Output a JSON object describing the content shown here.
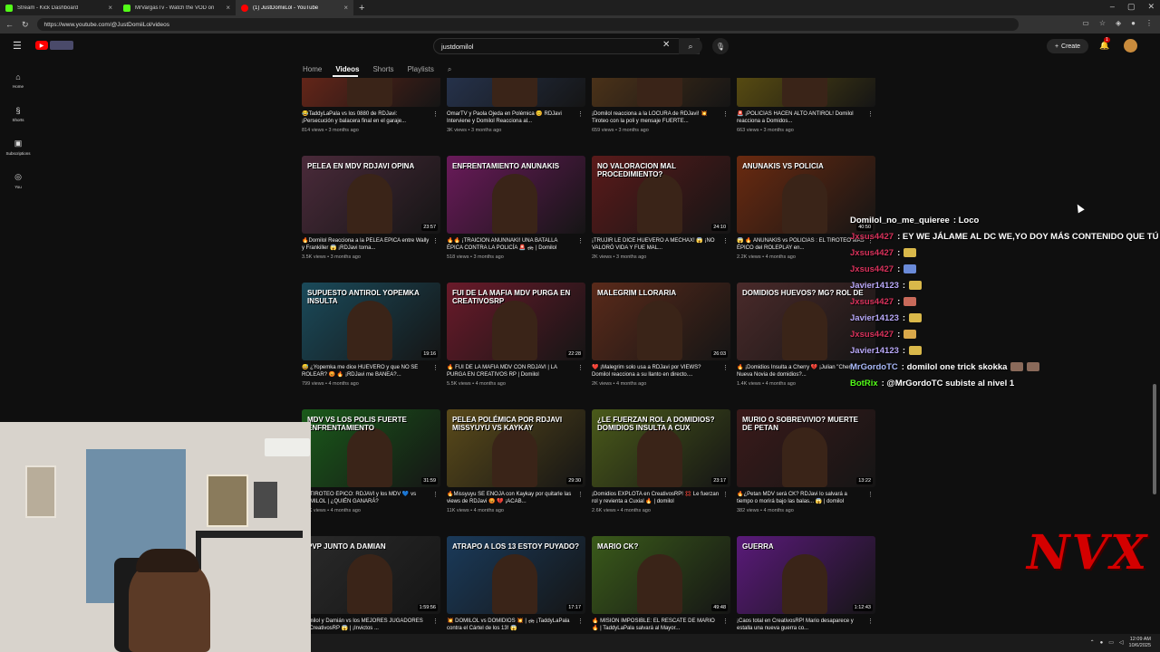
{
  "browser": {
    "tabs": [
      {
        "label": "Stream - Kick Dashboard",
        "color": "#53fc18"
      },
      {
        "label": "MrVargasTv - Watch the VOD on",
        "color": "#53fc18"
      },
      {
        "label": "(1) JustDomiiLol - YouTube",
        "color": "#ff0000"
      }
    ],
    "url": "https://www.youtube.com/@JustDomiiLol/videos"
  },
  "youtube": {
    "search_value": "justdomilol",
    "create_label": "Create",
    "notif_count": "1",
    "sidebar": [
      {
        "icon": "⌂",
        "label": "Home"
      },
      {
        "icon": "§",
        "label": "Shorts"
      },
      {
        "icon": "▣",
        "label": "Subscriptions"
      },
      {
        "icon": "◎",
        "label": "You"
      }
    ],
    "channel_tabs": {
      "home": "Home",
      "videos": "Videos",
      "shorts": "Shorts",
      "playlists": "Playlists"
    }
  },
  "videos": [
    {
      "title": "😂TaddyLaPala vs los 0880 de RDJavi: ¡Persecución y balacera final en el garaje...",
      "meta": "814 views • 3 months ago",
      "thumb_text": "",
      "duration": "",
      "color": "#7a2a1a"
    },
    {
      "title": "OmarTV y Paola Ojeda en Polémica 😊 RDJavi Interviene y Domilol Reacciona al...",
      "meta": "3K views • 3 months ago",
      "thumb_text": "",
      "duration": "",
      "color": "#2a3a5a"
    },
    {
      "title": "¡Domilol reacciona a la LOCURA de RDJavi! 💥 Tiroteo con la poli y mensaje FUERTE...",
      "meta": "659 views • 3 months ago",
      "thumb_text": "",
      "duration": "",
      "color": "#5a3a1a"
    },
    {
      "title": "🚨 ¡POLICÍAS HACEN ALTO ANTIROL! Domilol reacciona a Domidos...",
      "meta": "663 views • 3 months ago",
      "thumb_text": "",
      "duration": "",
      "color": "#6a5a10"
    },
    {
      "title": "🔥Domilol Reacciona a la PELEA ÉPICA entre Wally y Frankiller 😱 ¡RDJavi toma...",
      "meta": "3.5K views • 3 months ago",
      "thumb_text": "PELEA EN MDV RDJAVI OPINA",
      "duration": "23:57",
      "color": "#4a2a3a"
    },
    {
      "title": "🔥🔥 ¡TRAICIÓN ANUNNAKI! UNA BATALLA ÉPICA CONTRA LA POLICÍA 🚨 🚓 | Domilol",
      "meta": "518 views • 3 months ago",
      "thumb_text": "ENFRENTAMIENTO ANUNAKIS",
      "duration": "",
      "color": "#6a1a5a"
    },
    {
      "title": "¡TRUJIR LE DICE HUEVERO A MECHAX! 😱 ¡NO VALORÓ VIDA Y FUE MAL...",
      "meta": "2K views • 3 months ago",
      "thumb_text": "NO VALORACION MAL PROCEDIMIENTO?",
      "duration": "24:10",
      "color": "#5a1a1a"
    },
    {
      "title": "😱 🔥 ANUNAKIS vs POLICIAS : EL TIROTEO MÁS ÉPICO del ROLEPLAY en...",
      "meta": "2.2K views • 4 months ago",
      "thumb_text": "ANUNAKIS VS POLICIA",
      "duration": "40:50",
      "color": "#6a2a10"
    },
    {
      "title": "😅 ¿Yopemka me dice HUEVERO y que NO SÉ ROLEAR? 😡 🔥 ¡RDJavi me BANEA?...",
      "meta": "799 views • 4 months ago",
      "thumb_text": "SUPUESTO ANTIROL YOPEMKA INSULTA",
      "duration": "19:16",
      "color": "#1a4a5a"
    },
    {
      "title": "🔥 FUI DE LA MAFIA MDV CON RDJAVI | LA PURGA EN CREATIVOS RP | Domilol",
      "meta": "5.5K views • 4 months ago",
      "thumb_text": "FUI DE LA MAFIA MDV PURGA EN CREATIVOSRP",
      "duration": "22:28",
      "color": "#6a1a2a"
    },
    {
      "title": "❤️ ¡Malegrim solo usa a RDJavi por VIEWS? Domilol reacciona a su llanto en directo....",
      "meta": "2K views • 4 months ago",
      "thumb_text": "MALEGRIM LLORARIA",
      "duration": "26:03",
      "color": "#5a2a1a"
    },
    {
      "title": "🔥 ¡Domidios Insulta a Cherry 💔 ¡Julian \"Cherry\" Nueva Novia de domidios?...",
      "meta": "1.4K views • 4 months ago",
      "thumb_text": "DOMIDIOS HUEVOS? MG? ROL DE",
      "duration": "",
      "color": "#4a2a2a"
    },
    {
      "title": "💥 TIROTEO ÉPICO: RDJAVI y los MDV 💙 vs DOMILOL | ¿QUIÉN GANARÁ?",
      "meta": "3.1K views • 4 months ago",
      "thumb_text": "MDV VS LOS POLIS FUERTE ENFRENTAMIENTO",
      "duration": "31:59",
      "color": "#1a5a1a"
    },
    {
      "title": "🔥Missyuyu SE ENOJA con Kaykay por quitarle las views de RDJavi 😡 💔 ¡ACAB...",
      "meta": "11K views • 4 months ago",
      "thumb_text": "PELEA POLÉMICA POR RDJAVI MISSYUYU VS KAYKAY",
      "duration": "29:30",
      "color": "#5a4a1a"
    },
    {
      "title": "¡Domidios EXPLOTA en CreativosRP! 💢 Le fuerzan rol y revienta a Cuxial 🔥 | domilol",
      "meta": "2.6K views • 4 months ago",
      "thumb_text": "¿LE FUERZAN ROL A DOMIDIOS? DOMIDIOS INSULTA A CUX",
      "duration": "23:17",
      "color": "#4a5a1a"
    },
    {
      "title": "🔥¿Petan MDV será CK? RDJavi lo salvará a tiempo o morirá bajo las balas... 😱 | domilol",
      "meta": "382 views • 4 months ago",
      "thumb_text": "MURIO O SOBREVIVIO? MUERTE DE PETAN",
      "duration": "13:22",
      "color": "#3a1a1a"
    },
    {
      "title": "Domilol y Damián vs los MEJORES JUGADORES de CreativosRP 😱 | ¡Invictos ...",
      "meta": "1.4K views • 4 months ago",
      "thumb_text": "PVP JUNTO A DAMIAN",
      "duration": "1:59:56",
      "color": "#2a2a2a"
    },
    {
      "title": "💥 DOMILOL vs DOMIDIOS 💥 | 🚓 ¡TaddyLaPala contra el Cártel de los 13! 😱",
      "meta": "687 views • 4 months ago",
      "thumb_text": "ATRAPO A LOS 13 ESTOY PUYADO?",
      "duration": "17:17",
      "color": "#1a3a5a"
    },
    {
      "title": "🔥 MISIÓN IMPOSIBLE: EL RESCATE DE MARIO 🔥 | TaddyLaPala salvará al Mayor...",
      "meta": "1.4K views • 4 months ago",
      "thumb_text": "MARIO CK?",
      "duration": "49:48",
      "color": "#3a5a1a"
    },
    {
      "title": "¡Caos total en CreativosRP! Mario desaparece y estalla una nueva guerra co...",
      "meta": "833 views • 4 months ago",
      "thumb_text": "GUERRA",
      "duration": "1:12:43",
      "color": "#5a1a7a"
    }
  ],
  "chat": [
    {
      "name": "Domilol_no_me_quieree",
      "name_color": "#ffffff",
      "msg": ": Loco",
      "emotes": []
    },
    {
      "name": "Jxsus4427",
      "name_color": "#d8315b",
      "msg": ": EY WE JÁLAME AL DC WE,YO DOY MÁS CONTENIDO QUE TÚ",
      "emotes": []
    },
    {
      "name": "Jxsus4427",
      "name_color": "#d8315b",
      "msg": ":",
      "emotes": [
        "#d9b84a"
      ]
    },
    {
      "name": "Jxsus4427",
      "name_color": "#d8315b",
      "msg": ":",
      "emotes": [
        "#6a8ad8"
      ]
    },
    {
      "name": "Javier14123",
      "name_color": "#b8a8f8",
      "msg": ":",
      "emotes": [
        "#d9b84a"
      ]
    },
    {
      "name": "Jxsus4427",
      "name_color": "#d8315b",
      "msg": ":",
      "emotes": [
        "#c86a5a"
      ]
    },
    {
      "name": "Javier14123",
      "name_color": "#b8a8f8",
      "msg": ":",
      "emotes": [
        "#d9b84a"
      ]
    },
    {
      "name": "Jxsus4427",
      "name_color": "#d8315b",
      "msg": ":",
      "emotes": [
        "#d9a84a"
      ]
    },
    {
      "name": "Javier14123",
      "name_color": "#b8a8f8",
      "msg": ":",
      "emotes": [
        "#d9b84a"
      ]
    },
    {
      "name": "MrGordoTC",
      "name_color": "#a8b8f8",
      "msg": ": domilol one trick skokka",
      "emotes": [
        "#8a6a5a",
        "#8a6a5a"
      ]
    },
    {
      "name": "BotRix",
      "name_color": "#53fc18",
      "msg": ": @MrGordoTC subiste al nivel 1",
      "emotes": []
    }
  ],
  "overlay": {
    "logo": "NVX"
  },
  "system": {
    "time": "12:09 AM",
    "date": "10/6/2025"
  }
}
